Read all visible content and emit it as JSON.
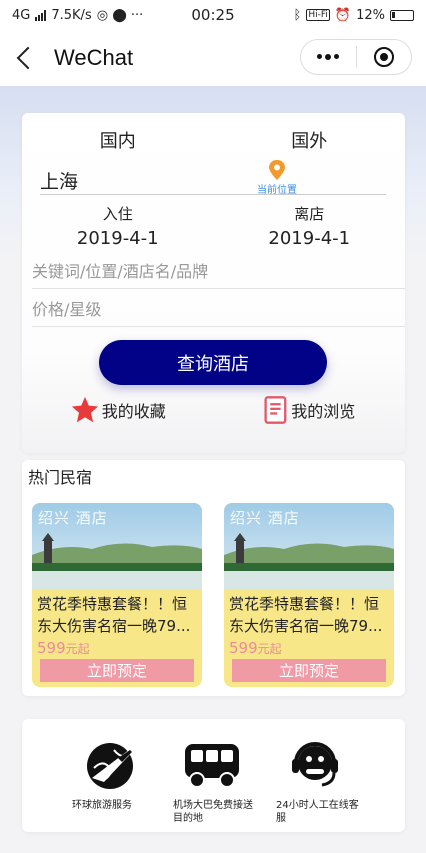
{
  "status_bar": {
    "network": "4G",
    "speed": "7.5K/s",
    "time": "00:25",
    "battery": "12%",
    "wifi_badge": "Hi-Fi"
  },
  "nav": {
    "title": "WeChat"
  },
  "search": {
    "tabs": [
      "国内",
      "国外"
    ],
    "city": "上海",
    "location_label": "当前位置",
    "checkin_label": "入住",
    "checkin_date": "2019-4-1",
    "checkout_label": "离店",
    "checkout_date": "2019-4-1",
    "keyword_placeholder": "关键词/位置/酒店名/品牌",
    "price_placeholder": "价格/星级",
    "search_button": "查询酒店",
    "favorites_label": "我的收藏",
    "history_label": "我的浏览"
  },
  "homestays": {
    "title": "热门民宿",
    "items": [
      {
        "tag": "绍兴  酒店",
        "desc": "赏花季特惠套餐！！恒东大伤害名宿一晚79...",
        "price": "599",
        "price_unit": "元起",
        "book": "立即预定"
      },
      {
        "tag": "绍兴  酒店",
        "desc": "赏花季特惠套餐！！恒东大伤害名宿一晚79...",
        "price": "599",
        "price_unit": "元起",
        "book": "立即预定"
      }
    ]
  },
  "services": [
    {
      "label": "环球旅游服务",
      "icon": "globe-plane-icon"
    },
    {
      "label": "机场大巴免费接送目的地",
      "icon": "bus-icon"
    },
    {
      "label": "24小时人工在线客服",
      "icon": "headset-agent-icon"
    }
  ],
  "colors": {
    "primary": "#010286",
    "card_yellow": "#f7e789",
    "book_pink": "#f09aa6",
    "star_red": "#e83a3a",
    "location_orange": "#f29a2e"
  }
}
